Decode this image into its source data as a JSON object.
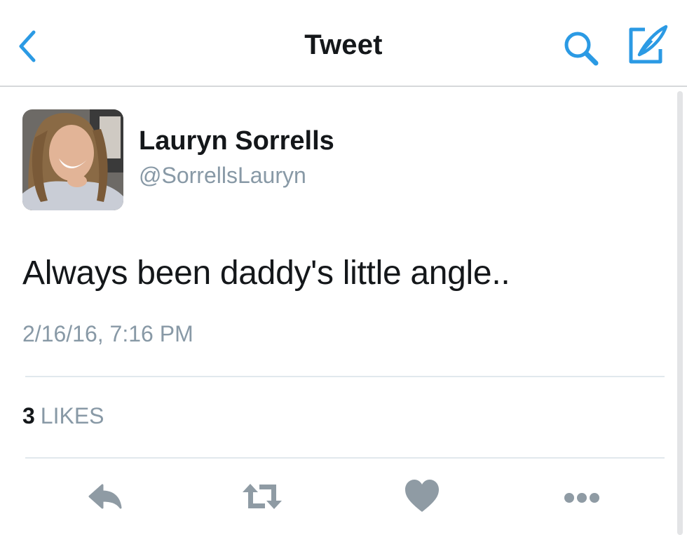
{
  "nav": {
    "title": "Tweet",
    "accent_color": "#2b9ae4"
  },
  "tweet": {
    "display_name": "Lauryn Sorrells",
    "handle": "@SorrellsLauryn",
    "text": "Always been daddy's little angle..",
    "timestamp": "2/16/16, 7:16 PM",
    "likes_count": "3",
    "likes_label": "LIKES"
  },
  "actions": {
    "icons": [
      "reply-icon",
      "retweet-icon",
      "like-icon",
      "more-icon"
    ],
    "icon_color": "#8f9ba4"
  }
}
